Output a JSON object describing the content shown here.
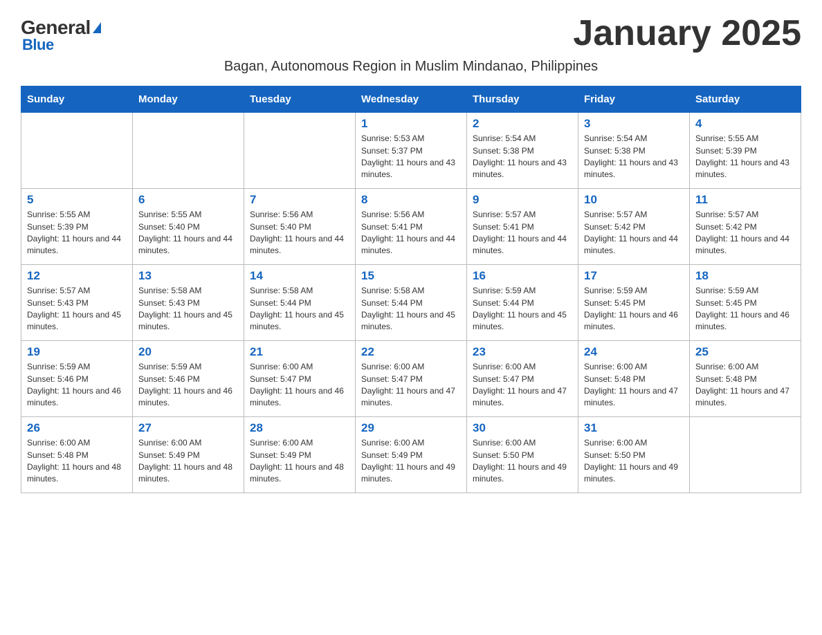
{
  "logo": {
    "general": "General",
    "blue": "Blue"
  },
  "title": "January 2025",
  "subtitle": "Bagan, Autonomous Region in Muslim Mindanao, Philippines",
  "days_of_week": [
    "Sunday",
    "Monday",
    "Tuesday",
    "Wednesday",
    "Thursday",
    "Friday",
    "Saturday"
  ],
  "weeks": [
    [
      {
        "day": "",
        "info": ""
      },
      {
        "day": "",
        "info": ""
      },
      {
        "day": "",
        "info": ""
      },
      {
        "day": "1",
        "info": "Sunrise: 5:53 AM\nSunset: 5:37 PM\nDaylight: 11 hours and 43 minutes."
      },
      {
        "day": "2",
        "info": "Sunrise: 5:54 AM\nSunset: 5:38 PM\nDaylight: 11 hours and 43 minutes."
      },
      {
        "day": "3",
        "info": "Sunrise: 5:54 AM\nSunset: 5:38 PM\nDaylight: 11 hours and 43 minutes."
      },
      {
        "day": "4",
        "info": "Sunrise: 5:55 AM\nSunset: 5:39 PM\nDaylight: 11 hours and 43 minutes."
      }
    ],
    [
      {
        "day": "5",
        "info": "Sunrise: 5:55 AM\nSunset: 5:39 PM\nDaylight: 11 hours and 44 minutes."
      },
      {
        "day": "6",
        "info": "Sunrise: 5:55 AM\nSunset: 5:40 PM\nDaylight: 11 hours and 44 minutes."
      },
      {
        "day": "7",
        "info": "Sunrise: 5:56 AM\nSunset: 5:40 PM\nDaylight: 11 hours and 44 minutes."
      },
      {
        "day": "8",
        "info": "Sunrise: 5:56 AM\nSunset: 5:41 PM\nDaylight: 11 hours and 44 minutes."
      },
      {
        "day": "9",
        "info": "Sunrise: 5:57 AM\nSunset: 5:41 PM\nDaylight: 11 hours and 44 minutes."
      },
      {
        "day": "10",
        "info": "Sunrise: 5:57 AM\nSunset: 5:42 PM\nDaylight: 11 hours and 44 minutes."
      },
      {
        "day": "11",
        "info": "Sunrise: 5:57 AM\nSunset: 5:42 PM\nDaylight: 11 hours and 44 minutes."
      }
    ],
    [
      {
        "day": "12",
        "info": "Sunrise: 5:57 AM\nSunset: 5:43 PM\nDaylight: 11 hours and 45 minutes."
      },
      {
        "day": "13",
        "info": "Sunrise: 5:58 AM\nSunset: 5:43 PM\nDaylight: 11 hours and 45 minutes."
      },
      {
        "day": "14",
        "info": "Sunrise: 5:58 AM\nSunset: 5:44 PM\nDaylight: 11 hours and 45 minutes."
      },
      {
        "day": "15",
        "info": "Sunrise: 5:58 AM\nSunset: 5:44 PM\nDaylight: 11 hours and 45 minutes."
      },
      {
        "day": "16",
        "info": "Sunrise: 5:59 AM\nSunset: 5:44 PM\nDaylight: 11 hours and 45 minutes."
      },
      {
        "day": "17",
        "info": "Sunrise: 5:59 AM\nSunset: 5:45 PM\nDaylight: 11 hours and 46 minutes."
      },
      {
        "day": "18",
        "info": "Sunrise: 5:59 AM\nSunset: 5:45 PM\nDaylight: 11 hours and 46 minutes."
      }
    ],
    [
      {
        "day": "19",
        "info": "Sunrise: 5:59 AM\nSunset: 5:46 PM\nDaylight: 11 hours and 46 minutes."
      },
      {
        "day": "20",
        "info": "Sunrise: 5:59 AM\nSunset: 5:46 PM\nDaylight: 11 hours and 46 minutes."
      },
      {
        "day": "21",
        "info": "Sunrise: 6:00 AM\nSunset: 5:47 PM\nDaylight: 11 hours and 46 minutes."
      },
      {
        "day": "22",
        "info": "Sunrise: 6:00 AM\nSunset: 5:47 PM\nDaylight: 11 hours and 47 minutes."
      },
      {
        "day": "23",
        "info": "Sunrise: 6:00 AM\nSunset: 5:47 PM\nDaylight: 11 hours and 47 minutes."
      },
      {
        "day": "24",
        "info": "Sunrise: 6:00 AM\nSunset: 5:48 PM\nDaylight: 11 hours and 47 minutes."
      },
      {
        "day": "25",
        "info": "Sunrise: 6:00 AM\nSunset: 5:48 PM\nDaylight: 11 hours and 47 minutes."
      }
    ],
    [
      {
        "day": "26",
        "info": "Sunrise: 6:00 AM\nSunset: 5:48 PM\nDaylight: 11 hours and 48 minutes."
      },
      {
        "day": "27",
        "info": "Sunrise: 6:00 AM\nSunset: 5:49 PM\nDaylight: 11 hours and 48 minutes."
      },
      {
        "day": "28",
        "info": "Sunrise: 6:00 AM\nSunset: 5:49 PM\nDaylight: 11 hours and 48 minutes."
      },
      {
        "day": "29",
        "info": "Sunrise: 6:00 AM\nSunset: 5:49 PM\nDaylight: 11 hours and 49 minutes."
      },
      {
        "day": "30",
        "info": "Sunrise: 6:00 AM\nSunset: 5:50 PM\nDaylight: 11 hours and 49 minutes."
      },
      {
        "day": "31",
        "info": "Sunrise: 6:00 AM\nSunset: 5:50 PM\nDaylight: 11 hours and 49 minutes."
      },
      {
        "day": "",
        "info": ""
      }
    ]
  ]
}
